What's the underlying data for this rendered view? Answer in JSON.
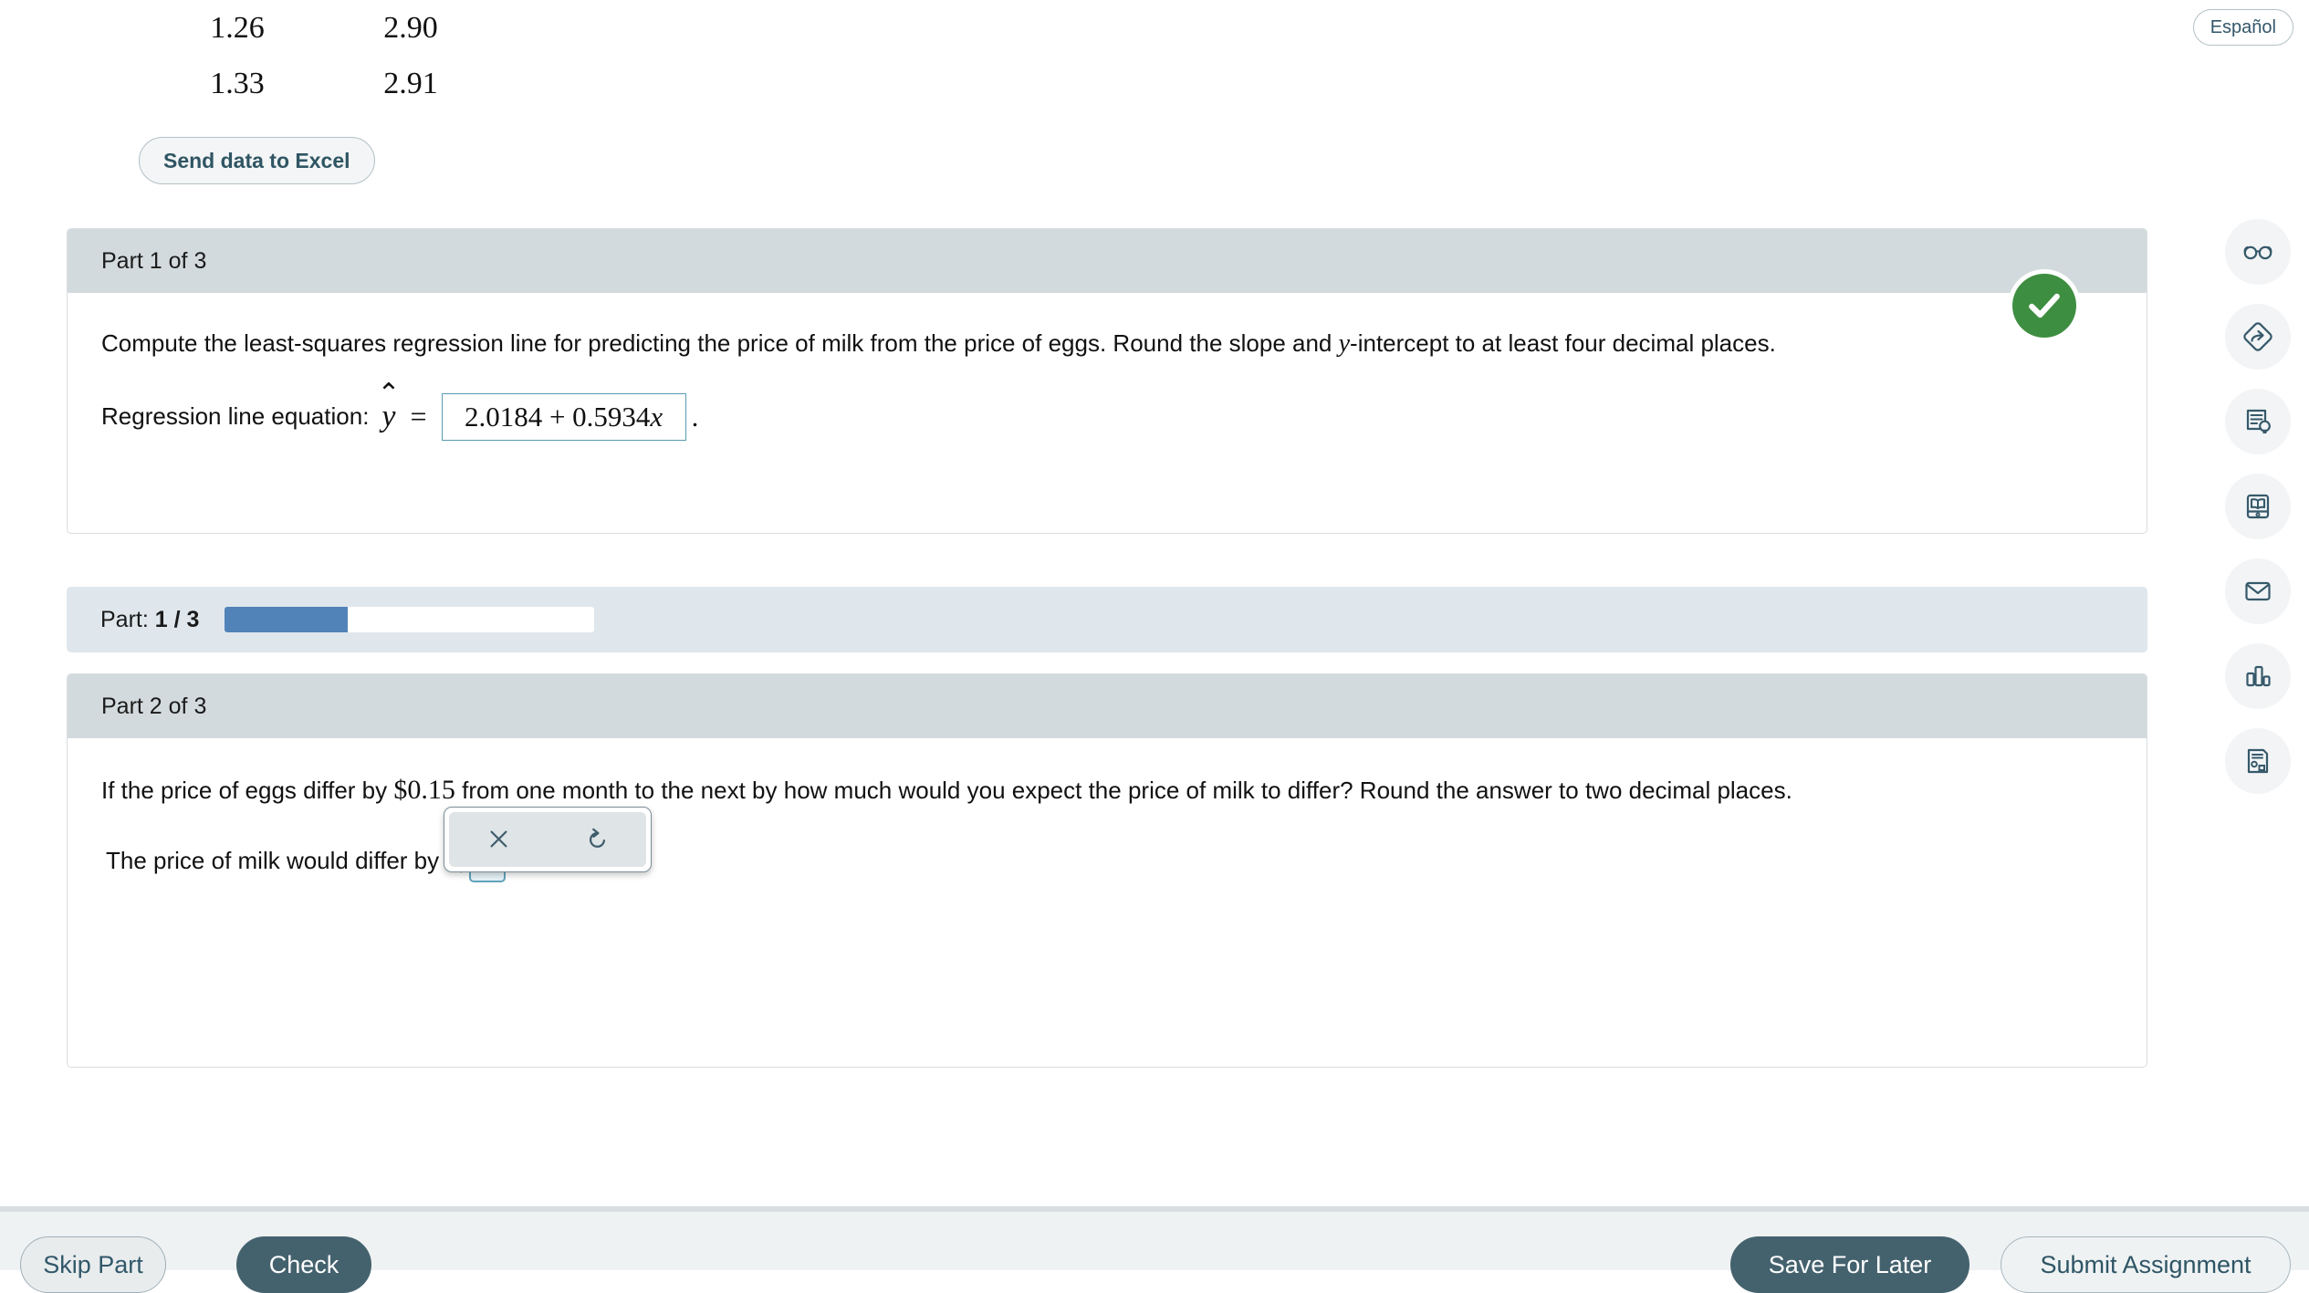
{
  "top_table": {
    "rows": [
      {
        "col1": "1.26",
        "col2": "2.90"
      },
      {
        "col1": "1.33",
        "col2": "2.91"
      }
    ]
  },
  "excel_button": {
    "label": "Send data to Excel"
  },
  "espanol_button": {
    "label": "Español"
  },
  "part1": {
    "header": "Part 1 of 3",
    "question_a": "Compute the least-squares regression line for predicting the price of milk from the price of eggs. Round the slope and ",
    "question_var": "y",
    "question_b": "-intercept to at least four decimal places.",
    "answer_label": "Regression line equation:",
    "yhat_var": "y",
    "hat_glyph": "⌃",
    "equals": "=",
    "answer_value_number": "2.0184 + 0.5934",
    "answer_value_var": "x",
    "period": ".",
    "status": "correct",
    "check_icon": "check-icon"
  },
  "progress": {
    "label_prefix": "Part:",
    "current": "1",
    "separator": "/",
    "total": "3",
    "percent": 33.33,
    "fill_color": "#5183b8"
  },
  "part2": {
    "header": "Part 2 of 3",
    "question_a": "If the price of eggs differ by ",
    "question_amount": "$0.15",
    "question_b": " from one month to the next by how much would you expect the price of milk to differ? Round the answer to two decimal places.",
    "answer_prefix": "The price of milk would differ by",
    "dollar_sign": "$",
    "answer_value": "",
    "period": ".",
    "toolbar": {
      "clear_icon": "close-x-icon",
      "undo_icon": "undo-icon"
    }
  },
  "rail": {
    "items": [
      {
        "icon": "glasses-icon",
        "name": "read-aloud"
      },
      {
        "icon": "diamond-arrow-icon",
        "name": "hint"
      },
      {
        "icon": "document-bulb-icon",
        "name": "explain"
      },
      {
        "icon": "ebook-icon",
        "name": "textbook"
      },
      {
        "icon": "envelope-icon",
        "name": "message"
      },
      {
        "icon": "bar-chart-icon",
        "name": "statistics"
      },
      {
        "icon": "worksheet-icon",
        "name": "worksheet"
      }
    ]
  },
  "bottom_bar": {
    "skip_label": "Skip Part",
    "check_label": "Check",
    "save_label": "Save For Later",
    "submit_label": "Submit Assignment"
  },
  "colors": {
    "card_header": "#d3dadd",
    "accent_dark": "#44626e",
    "success_green": "#3e8e41",
    "progress_blue": "#5183b8",
    "input_blue_border": "#62a3bb"
  }
}
